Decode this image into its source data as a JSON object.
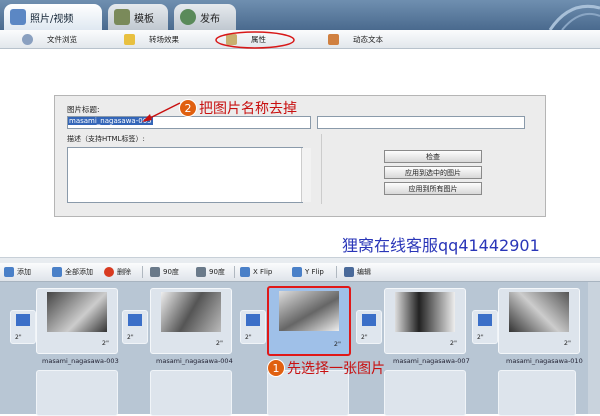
{
  "tabs": [
    {
      "label": "照片/视频"
    },
    {
      "label": "模板"
    },
    {
      "label": "发布"
    }
  ],
  "subtabs": [
    {
      "label": "文件浏览"
    },
    {
      "label": "转场效果"
    },
    {
      "label": "属性"
    },
    {
      "label": "动态文本"
    }
  ],
  "props": {
    "title_label": "图片标题:",
    "title_value": "masami_nagasawa-005",
    "desc_label": "描述（支持HTML标签）:",
    "btn_preview": "检查",
    "btn_apply_selected": "应用到选中的图片",
    "btn_apply_all": "应用到所有图片"
  },
  "annot": {
    "step2": "把图片名称去掉",
    "step2_num": "2",
    "step1": "先选择一张图片",
    "step1_num": "1"
  },
  "watermark": "狸窝在线客服qq41442901",
  "toolbar": {
    "add": "添加",
    "add_all": "全部添加",
    "delete": "删除",
    "rot1": "90度",
    "rot2": "90度",
    "xflip": "X Flip",
    "yflip": "Y Flip",
    "edit": "编辑"
  },
  "frames": [
    {
      "caption": "masami_nagasawa-003",
      "duration": "2\""
    },
    {
      "caption": "masami_nagasawa-004",
      "duration": "2\""
    },
    {
      "caption": "",
      "duration": "2\""
    },
    {
      "caption": "masami_nagasawa-007",
      "duration": "2\""
    },
    {
      "caption": "masami_nagasawa-010",
      "duration": "2\""
    }
  ],
  "transitions": [
    {
      "duration": "2\""
    },
    {
      "duration": "2\""
    },
    {
      "duration": "2\""
    },
    {
      "duration": "2\""
    },
    {
      "duration": "2\""
    }
  ],
  "colors": {
    "accent": "#3466b8",
    "annotation": "#c81010",
    "watermark": "#2a36b8"
  }
}
